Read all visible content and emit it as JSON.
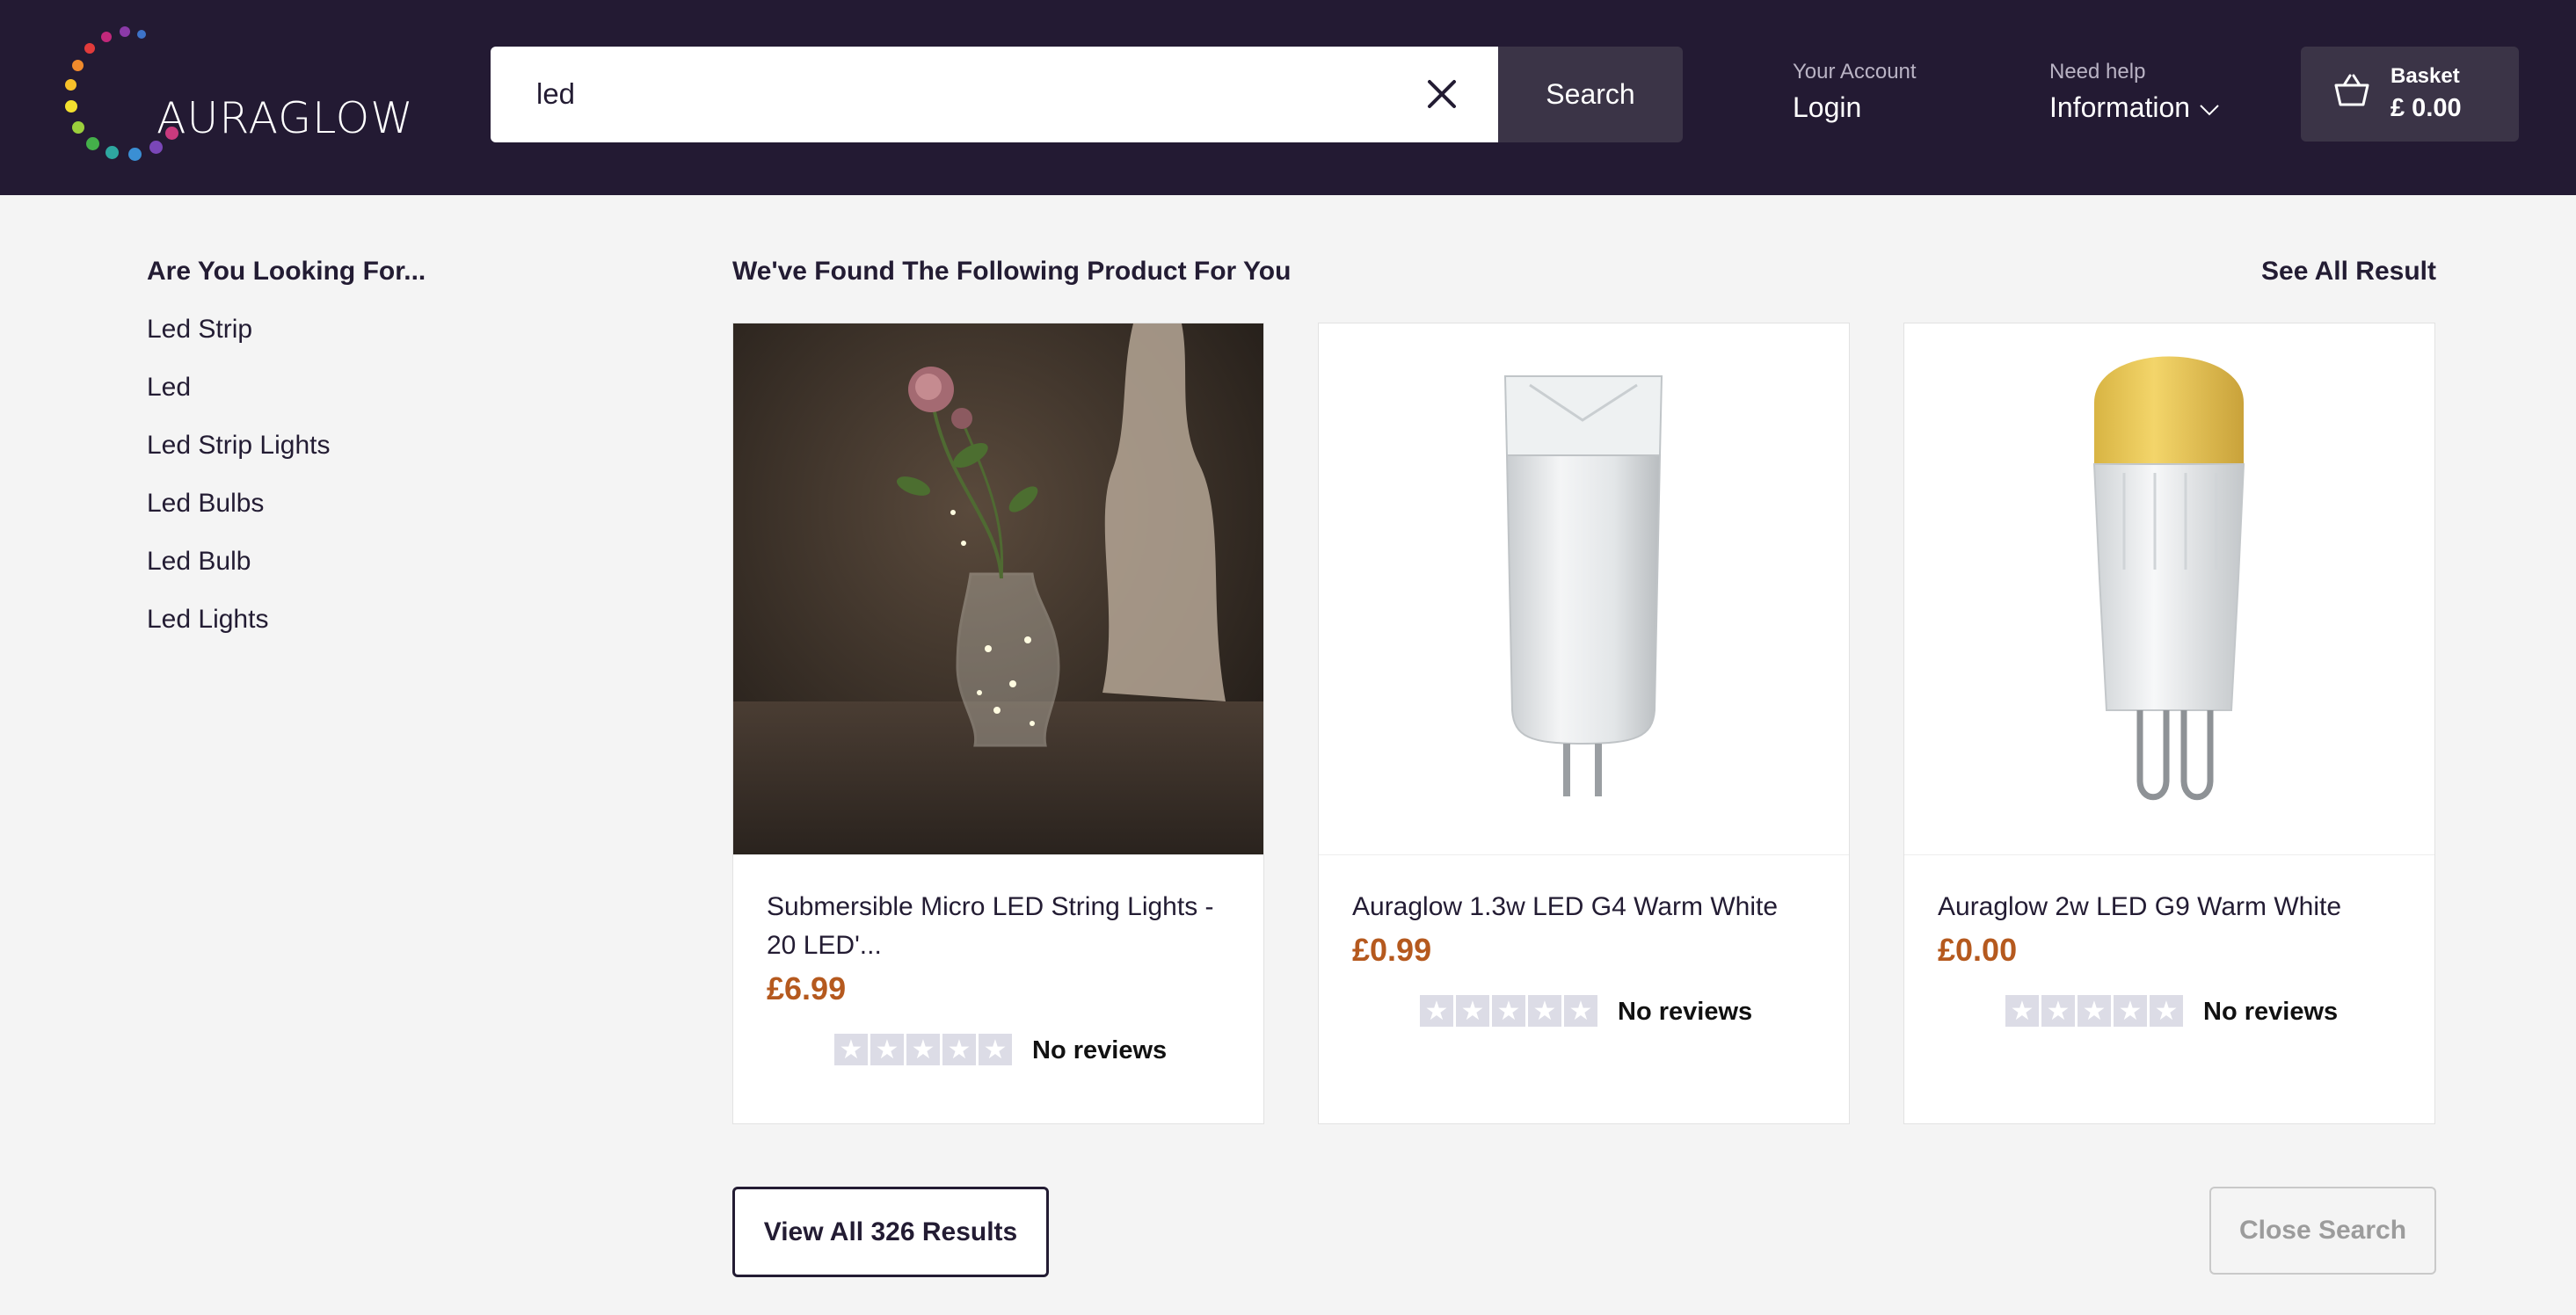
{
  "header": {
    "logo_text": "AURAGLOW",
    "search": {
      "value": "led",
      "placeholder": ""
    },
    "search_button": "Search",
    "account": {
      "label": "Your Account",
      "action": "Login"
    },
    "help": {
      "label": "Need help",
      "action": "Information"
    },
    "basket": {
      "label": "Basket",
      "amount": "£ 0.00"
    }
  },
  "suggestions": {
    "title": "Are You Looking For...",
    "items": [
      "Led Strip",
      "Led",
      "Led Strip Lights",
      "Led Bulbs",
      "Led Bulb",
      "Led Lights"
    ]
  },
  "results": {
    "title": "We've Found The Following Product For You",
    "see_all": "See All Result",
    "products": [
      {
        "name": "Submersible Micro  LED  String Lights - 20  LED'...",
        "price": "£6.99",
        "rating": 0,
        "reviews": "No reviews"
      },
      {
        "name": "Auraglow 1.3w  LED  G4 Warm White",
        "price": "£0.99",
        "rating": 0,
        "reviews": "No reviews"
      },
      {
        "name": "Auraglow 2w  LED  G9 Warm White",
        "price": "£0.00",
        "rating": 0,
        "reviews": "No reviews"
      }
    ]
  },
  "footer_buttons": {
    "view_all": "View All 326 Results",
    "close_search": "Close Search"
  },
  "colors": {
    "header_bg": "#231a33",
    "button_bg": "#3b3447",
    "price": "#b5591e",
    "page_bg": "#f4f4f4"
  },
  "icons": [
    "clear-icon",
    "basket-icon",
    "chevron-down-icon",
    "star-icon"
  ]
}
